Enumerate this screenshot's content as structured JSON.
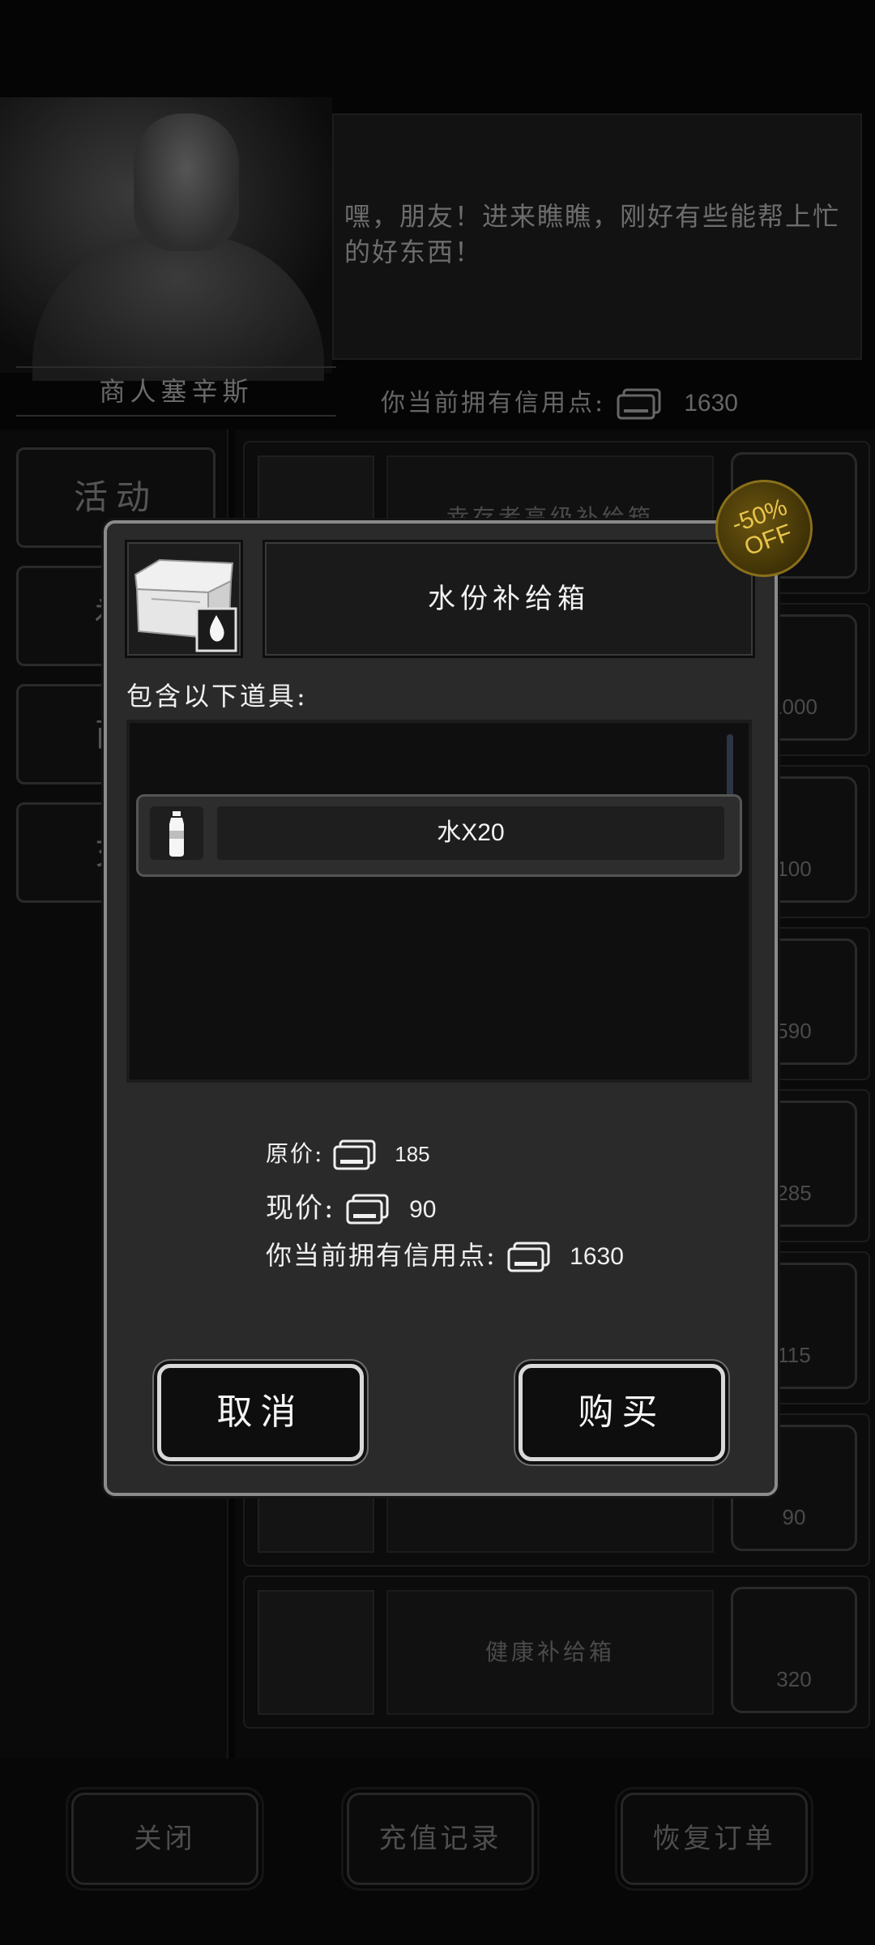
{
  "background": {
    "merchant_name": "商人塞辛斯",
    "greeting": "嘿，朋友！进来瞧瞧，刚好有些能帮上忙的好东西！",
    "credit_label": "你当前拥有信用点:",
    "credit_value": "1630",
    "side_tabs": [
      "活动",
      "福",
      "商",
      "充"
    ],
    "shop_items": [
      {
        "name": "幸存者高级补给箱",
        "price": ""
      },
      {
        "name": "",
        "price": "1000"
      },
      {
        "name": "",
        "price": "100"
      },
      {
        "name": "",
        "price": "590"
      },
      {
        "name": "",
        "price": "285"
      },
      {
        "name": "",
        "price": "115"
      },
      {
        "name": "",
        "price": "90"
      },
      {
        "name": "健康补给箱",
        "price": "320"
      }
    ],
    "bottom_buttons": {
      "close": "关闭",
      "recharge_history": "充值记录",
      "restore_order": "恢复订单"
    }
  },
  "modal": {
    "title": "水份补给箱",
    "discount": {
      "percent": "-50%",
      "off": "OFF"
    },
    "contains_label": "包含以下道具:",
    "items": [
      {
        "name": "水X20",
        "icon": "water-bottle-icon"
      }
    ],
    "original_price_label": "原价:",
    "original_price": "185",
    "current_price_label": "现价:",
    "current_price": "90",
    "owned_label": "你当前拥有信用点:",
    "owned_value": "1630",
    "cancel_label": "取消",
    "buy_label": "购买"
  },
  "colors": {
    "accent_gold": "#e9c54b",
    "modal_bg": "#2a2a2a",
    "modal_border": "#8b8b8b"
  }
}
